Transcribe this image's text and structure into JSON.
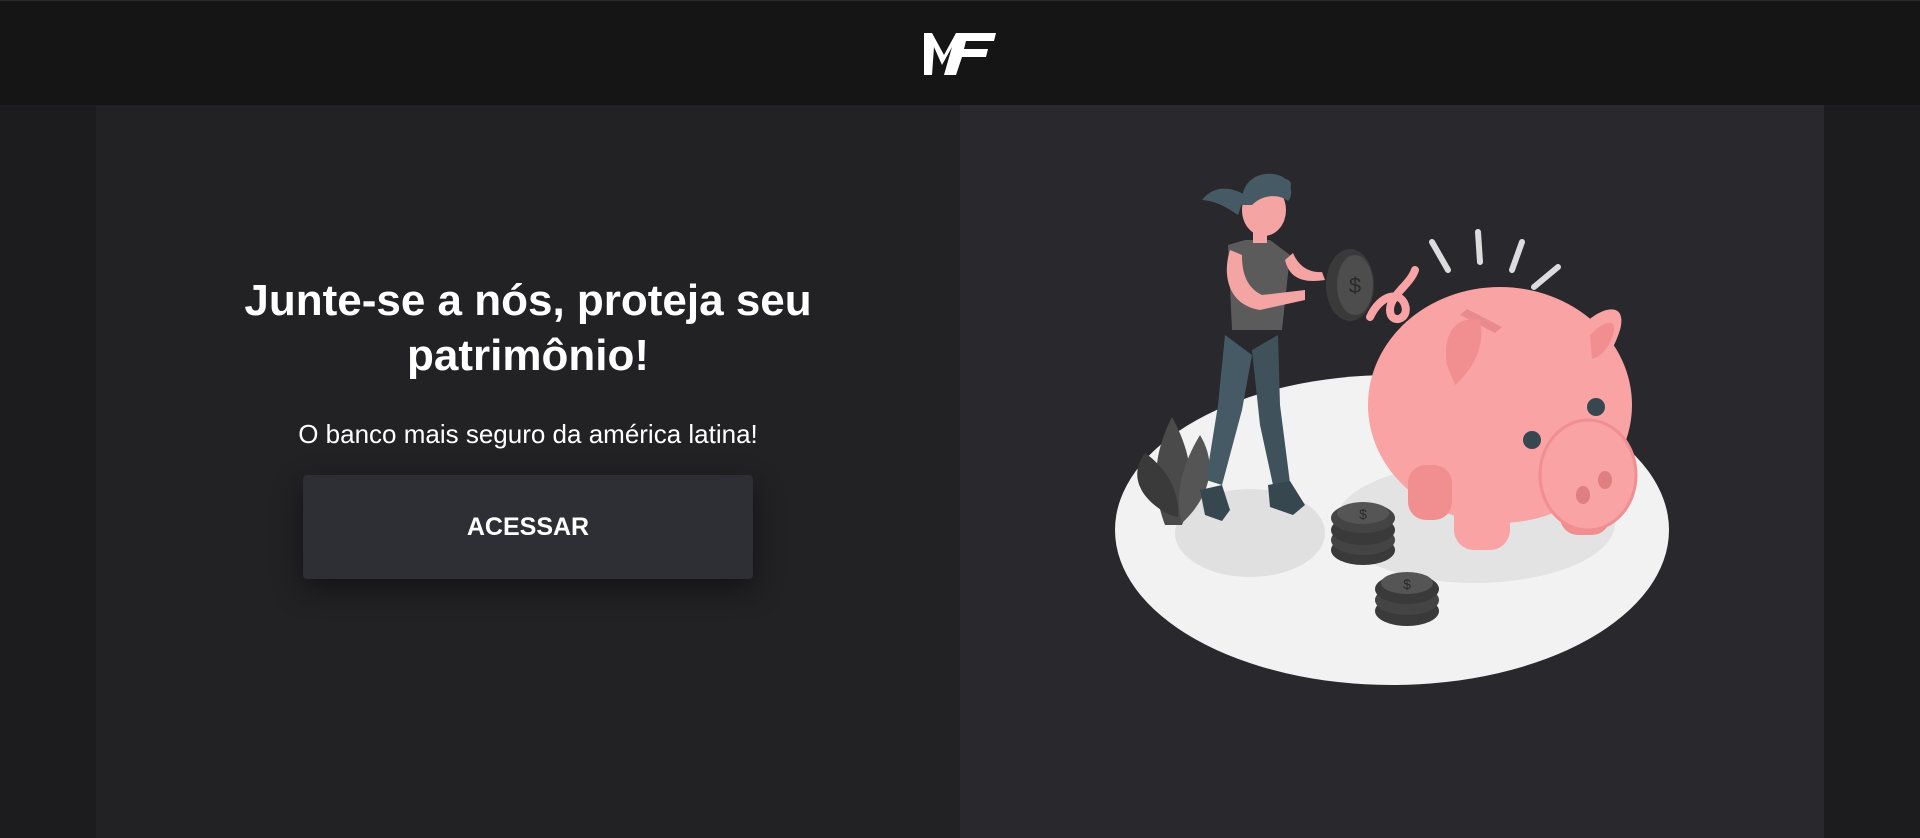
{
  "header": {
    "logo_text": "MF"
  },
  "hero": {
    "headline": "Junte-se a nós, proteja seu patrimônio!",
    "tagline": "O banco mais seguro da américa latina!",
    "cta_label": "ACESSAR"
  },
  "colors": {
    "header_bg": "#151515",
    "left_panel_bg": "#222224",
    "right_panel_bg": "#29292d",
    "button_bg": "#2d2f34",
    "pig_pink": "#f9a3a4",
    "text": "#ffffff"
  },
  "illustration": {
    "icon": "piggy-bank-savings-illustration"
  }
}
